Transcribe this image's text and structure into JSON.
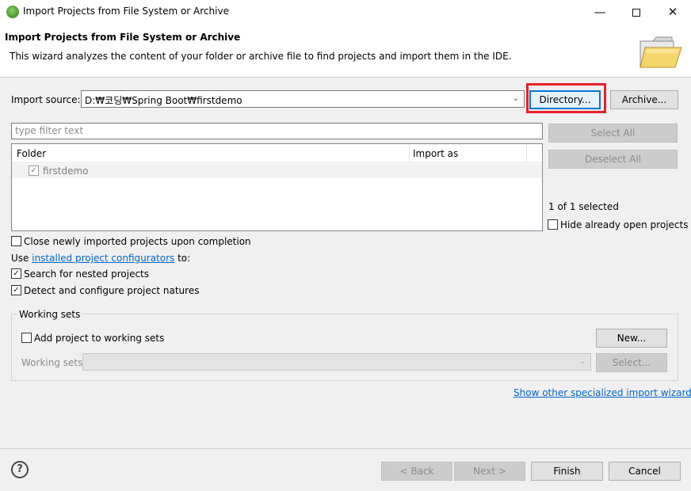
{
  "window": {
    "title": "Import Projects from File System or Archive",
    "minimize": "—",
    "close": "✕"
  },
  "header": {
    "title": "Import Projects from File System or Archive",
    "description": "This wizard analyzes the content of your folder or archive file to find projects and import them in the IDE."
  },
  "source": {
    "label": "Import source:",
    "value": "D:₩코딩₩Spring Boot₩firstdemo",
    "directory_button": "Directory...",
    "archive_button": "Archive..."
  },
  "filter": {
    "placeholder": "type filter text"
  },
  "tree": {
    "columns": [
      "Folder",
      "Import as"
    ],
    "rows": [
      {
        "folder": "firstdemo",
        "import_as": "",
        "checked": true
      }
    ]
  },
  "side": {
    "select_all": "Select All",
    "deselect_all": "Deselect All",
    "selected_count": "1 of 1 selected",
    "hide_open": "Hide already open projects"
  },
  "options": {
    "close_newly": "Close newly imported projects upon completion",
    "use_prefix": "Use ",
    "configurators_link": "installed project configurators",
    "use_suffix": " to:",
    "search_nested": "Search for nested projects",
    "detect_natures": "Detect and configure project natures"
  },
  "working_sets": {
    "title": "Working sets",
    "add_label": "Add project to working sets",
    "new_button": "New...",
    "sets_label": "Working sets:",
    "select_button": "Select..."
  },
  "other_wizards_link": "Show other specialized import wizards",
  "footer": {
    "help": "?",
    "back": "< Back",
    "next": "Next >",
    "finish": "Finish",
    "cancel": "Cancel"
  },
  "colors": {
    "highlight": "#e8202a",
    "link": "#0066cc",
    "focus": "#0078d7"
  }
}
